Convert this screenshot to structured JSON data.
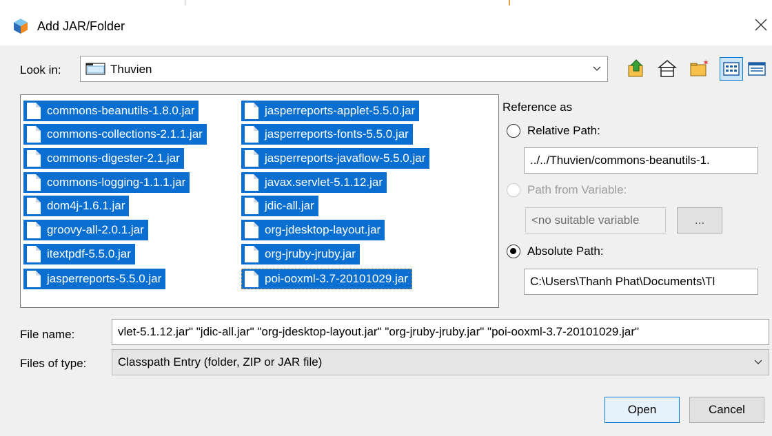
{
  "window": {
    "title": "Add JAR/Folder",
    "icon": "netbeans-cube-icon"
  },
  "look_in": {
    "label": "Look in:",
    "value": "Thuvien",
    "icon": "folder-icon"
  },
  "toolbar": [
    {
      "name": "up-one-level-button",
      "icon": "folder-up-icon"
    },
    {
      "name": "home-button",
      "icon": "home-icon"
    },
    {
      "name": "new-folder-button",
      "icon": "new-folder-icon"
    },
    {
      "name": "list-view-button",
      "icon": "list-view-icon",
      "active": true
    },
    {
      "name": "details-view-button",
      "icon": "details-view-icon"
    }
  ],
  "files": {
    "column1": [
      "commons-beanutils-1.8.0.jar",
      "commons-collections-2.1.1.jar",
      "commons-digester-2.1.jar",
      "commons-logging-1.1.1.jar",
      "dom4j-1.6.1.jar",
      "groovy-all-2.0.1.jar",
      "itextpdf-5.5.0.jar",
      "jasperreports-5.5.0.jar"
    ],
    "column2": [
      "jasperreports-applet-5.5.0.jar",
      "jasperreports-fonts-5.5.0.jar",
      "jasperreports-javaflow-5.5.0.jar",
      "javax.servlet-5.1.12.jar",
      "jdic-all.jar",
      "org-jdesktop-layout.jar",
      "org-jruby-jruby.jar",
      "poi-ooxml-3.7-20101029.jar"
    ],
    "selection_color": "#0a6fd0"
  },
  "reference": {
    "heading": "Reference as",
    "relative_label": "Relative Path:",
    "relative_value": "../../Thuvien/commons-beanutils-1.",
    "variable_label": "Path from Variable:",
    "variable_value": "<no suitable variable",
    "variable_button": "...",
    "absolute_label": "Absolute Path:",
    "absolute_value": "C:\\Users\\Thanh Phat\\Documents\\Tl",
    "selected": "absolute"
  },
  "file_name": {
    "label": "File name:",
    "value": "vlet-5.1.12.jar\" \"jdic-all.jar\" \"org-jdesktop-layout.jar\" \"org-jruby-jruby.jar\" \"poi-ooxml-3.7-20101029.jar\""
  },
  "files_of_type": {
    "label": "Files of type:",
    "value": "Classpath Entry (folder, ZIP or JAR file)"
  },
  "buttons": {
    "open": "Open",
    "cancel": "Cancel"
  }
}
